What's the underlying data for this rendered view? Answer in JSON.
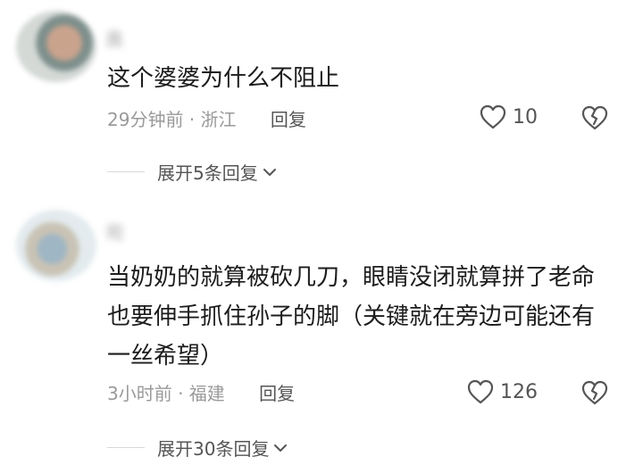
{
  "comments": [
    {
      "username": "良",
      "text": "这个婆婆为什么不阻止",
      "time_location": "29分钟前 · 浙江",
      "reply_label": "回复",
      "likes": "10",
      "expand_label": "展开5条回复"
    },
    {
      "username": "司",
      "text": "当奶奶的就算被砍几刀，眼睛没闭就算拼了老命也要伸手抓住孙子的脚（关键就在旁边可能还有一丝希望）",
      "time_location": "3小时前 · 福建",
      "reply_label": "回复",
      "likes": "126",
      "expand_label": "展开30条回复"
    }
  ],
  "icons": {
    "like": "heart-outline-icon",
    "dislike": "broken-heart-icon",
    "expand": "chevron-down-icon"
  },
  "colors": {
    "text": "#1c1c1c",
    "meta": "#9a9a9a",
    "action": "#555555"
  }
}
